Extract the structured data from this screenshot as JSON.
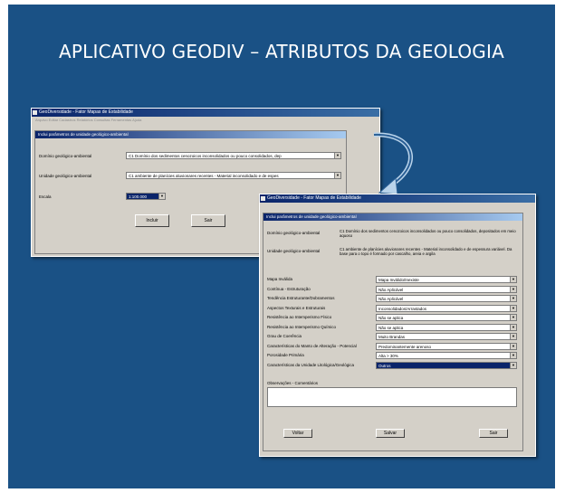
{
  "slide": {
    "title": "APLICATIVO GEODIV – ATRIBUTOS DA GEOLOGIA"
  },
  "win1": {
    "title": "GeoDiversidade - Fator Mapas de Estabilidade",
    "menu": "Arquivo  Editar  Cadastros  Relatórios  Consultas  Ferramentas  Ajuda",
    "dialog_title": "Inclui parâmetros de unidade geológico-ambiental",
    "fields": [
      {
        "label": "Domínio geológico-ambiental",
        "value": "C1 Domínio dos sedimentos cenozoicos inconsolidados ou pouco consolidados, dep"
      },
      {
        "label": "Unidade geológico-ambiental",
        "value": "C1 ambiente de planícies aluvionares recentes - Material inconsolidado e de espes"
      },
      {
        "label": "Escala",
        "value": "1:100.000"
      }
    ],
    "buttons": {
      "ok": "Incluir",
      "cancel": "Sair"
    }
  },
  "win2": {
    "title": "GeoDiversidade - Fator Mapas de Estabilidade",
    "dialog_title": "Inclui parâmetros de unidade geológico-ambiental",
    "info": [
      {
        "label": "Domínio geológico-ambiental",
        "text": "C1 Domínio dos sedimentos cenozoicos inconsolidados ou pouco consolidados, depositados em meio aquoso"
      },
      {
        "label": "Unidade geológico-ambiental",
        "text": "C1 ambiente de planícies aluvionares recentes - Material inconsolidado e de espessura variável. Da base para o topo é formado por cascalho, areia e argila"
      }
    ],
    "attributes": [
      {
        "label": "Mapa Inválida",
        "value": "Mapa Inválido/Inexiste"
      },
      {
        "label": "Contínua - Estruturação",
        "value": "Não Aplicável"
      },
      {
        "label": "Tendência Estruturante/Dobramentos",
        "value": "Não Aplicável"
      },
      {
        "label": "Aspectos Texturais e Estruturais",
        "value": "Inconsolidados/Arrastados"
      },
      {
        "label": "Resistência ao Intemperismo Físico",
        "value": "Não se aplica"
      },
      {
        "label": "Resistência ao Intemperismo Químico",
        "value": "Não se aplica"
      },
      {
        "label": "Grau de Coerência",
        "value": "Muito Brandas"
      },
      {
        "label": "Características do Manto de Alteração - Potencial",
        "value": "Predominantemente arenoso"
      },
      {
        "label": "Porosidade Primária",
        "value": "Alta > 30%"
      },
      {
        "label": "Características da Unidade Litológica/Geológica",
        "value": "Outros"
      }
    ],
    "notes_label": "Observações - Comentários",
    "buttons": {
      "back": "Voltar",
      "save": "Salvar",
      "exit": "Sair"
    }
  }
}
